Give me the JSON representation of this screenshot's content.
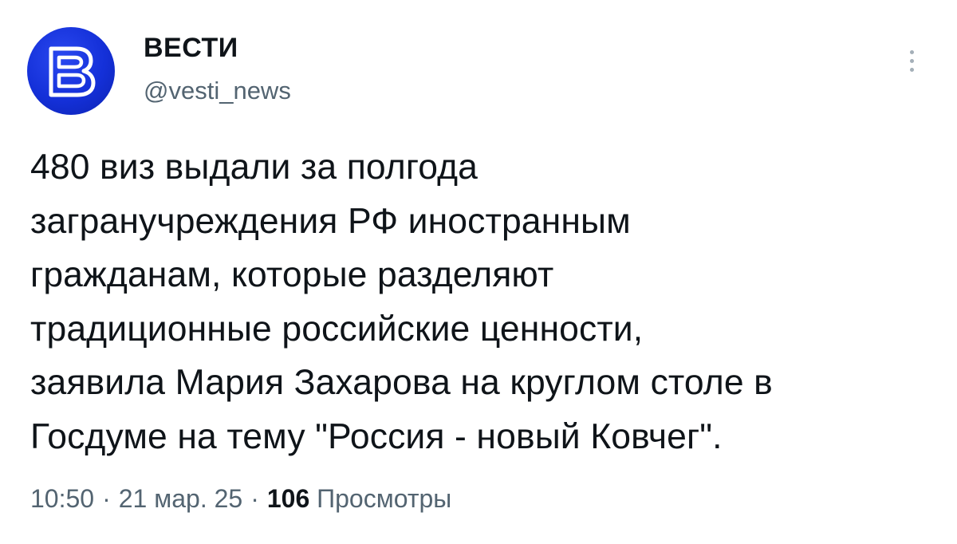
{
  "author": {
    "name": "ВЕСТИ",
    "handle": "@vesti_news",
    "avatar_icon": "vesti-logo-icon",
    "avatar_color": "#1430d8"
  },
  "more_menu": {
    "icon": "more-vertical-icon"
  },
  "tweet": {
    "text": "480 виз выдали за полгода\nзагранучреждения РФ иностранным\nгражданам, которые разделяют\nтрадиционные российские ценности,\nзаявила Мария Захарова на круглом столе в\nГосдуме на тему \"Россия - новый Ковчег\"."
  },
  "meta": {
    "time": "10:50",
    "date": "21 мар. 25",
    "separator": "·",
    "views_count": "106",
    "views_label": "Просмотры"
  }
}
